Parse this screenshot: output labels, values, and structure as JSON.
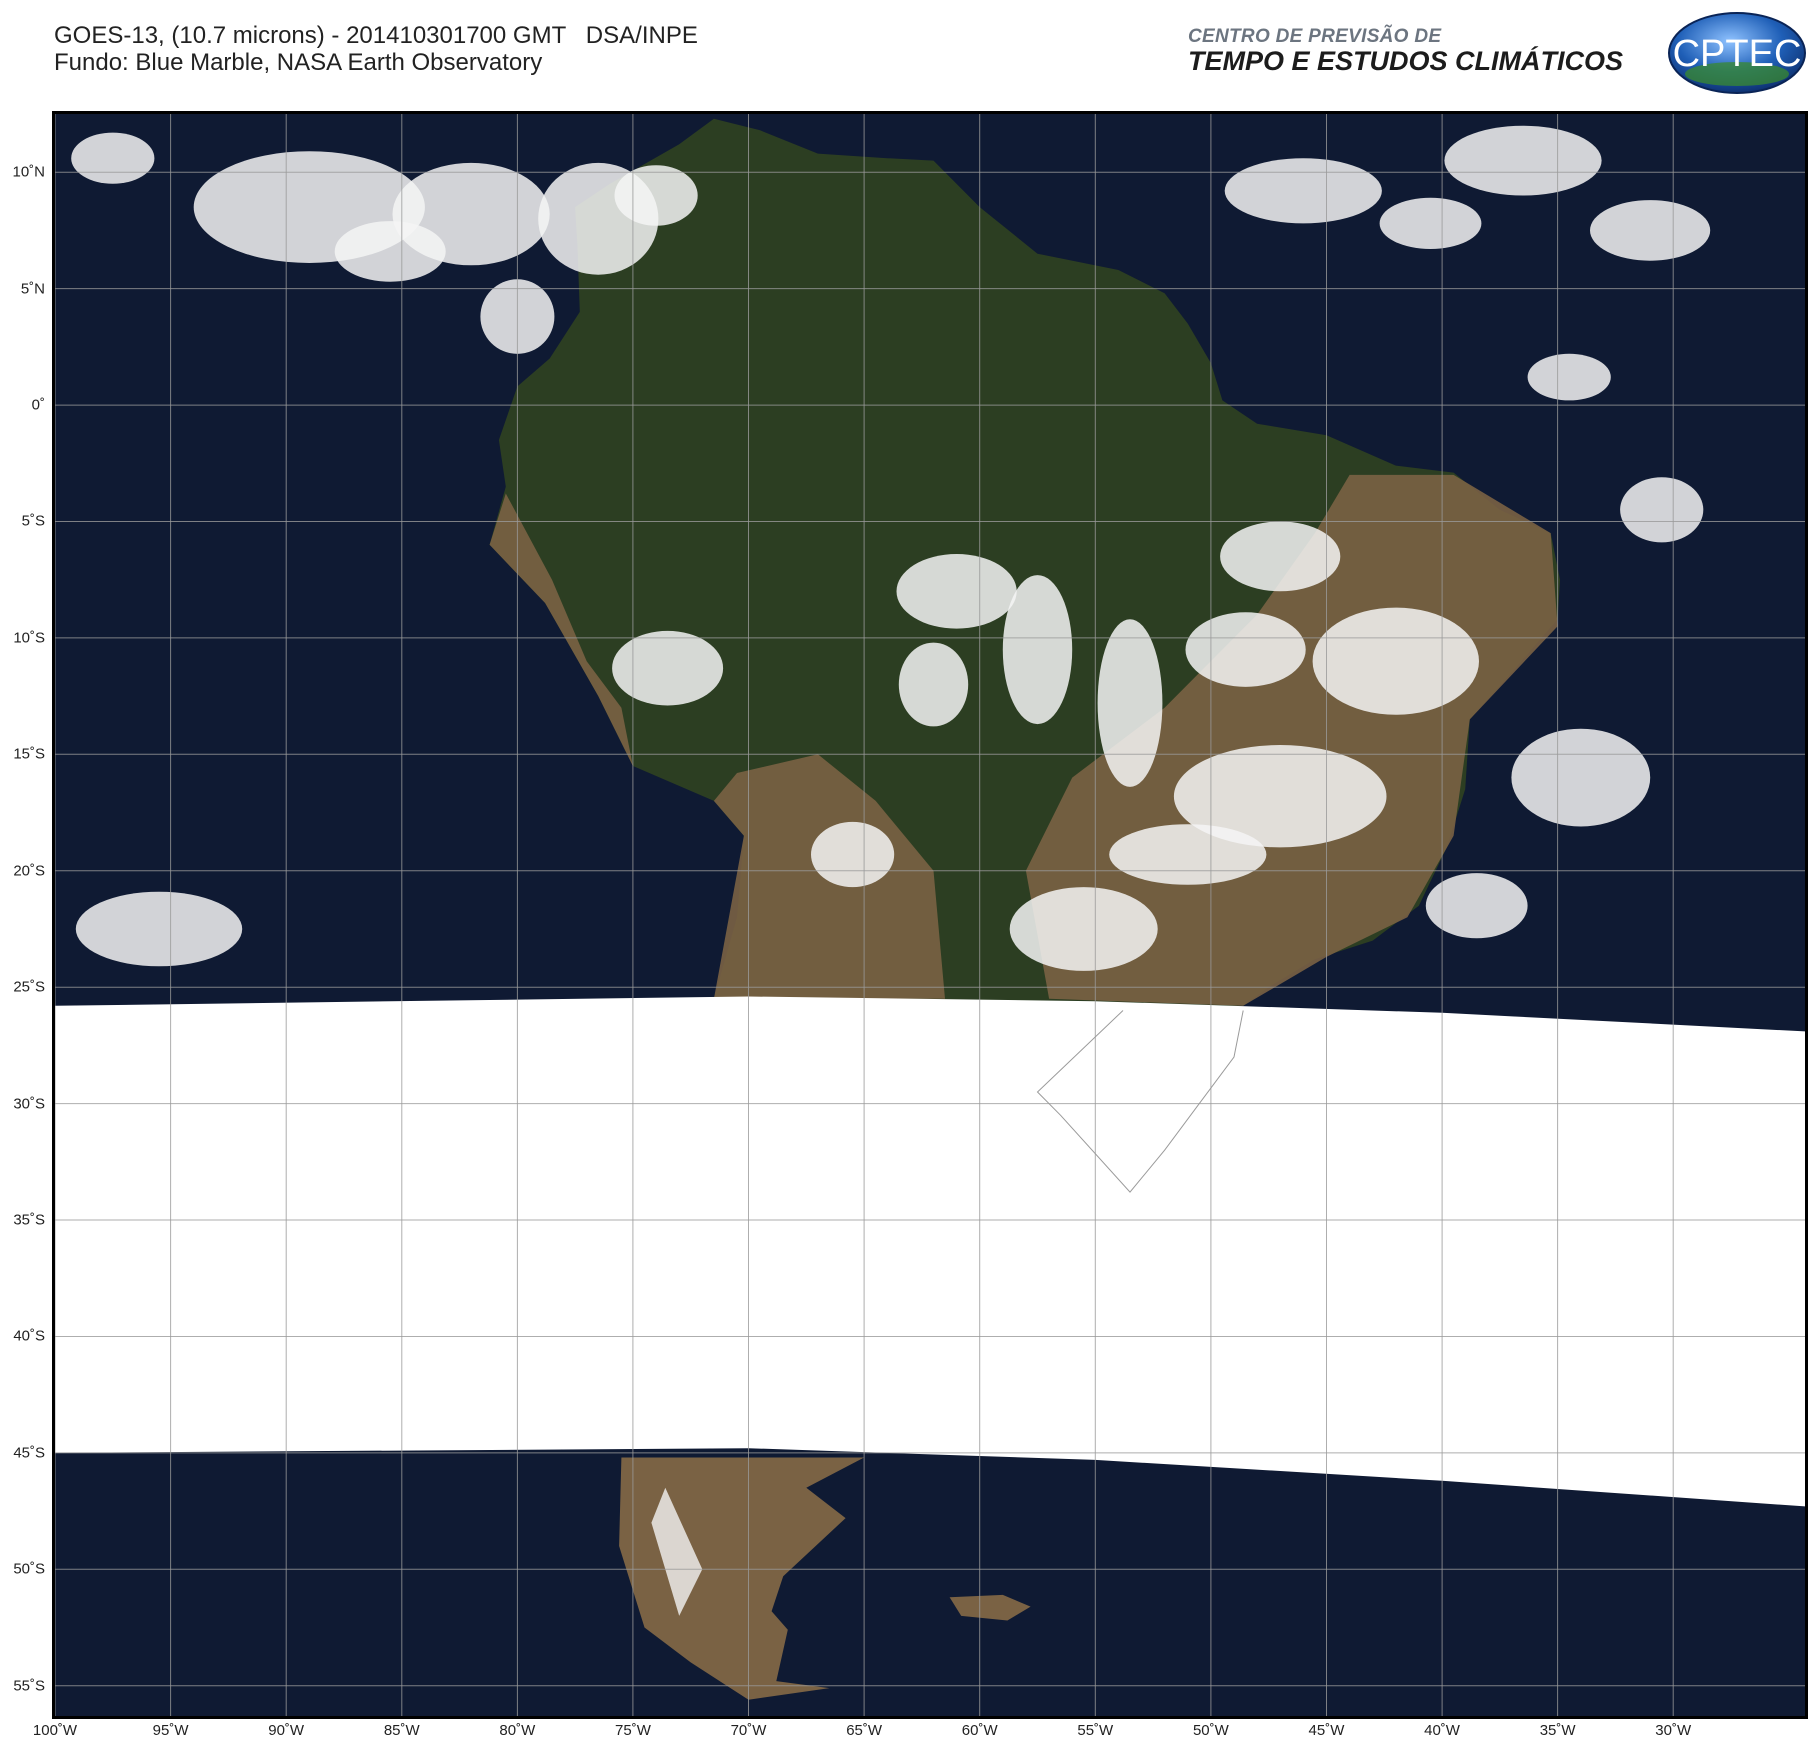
{
  "header": {
    "line1": "GOES-13, (10.7 microns) - 201410301700 GMT   DSA/INPE",
    "line2": "Fundo: Blue Marble, NASA Earth Observatory"
  },
  "organization": {
    "subtitle": "CENTRO DE PREVISÃO DE",
    "title": "TEMPO E ESTUDOS CLIMÁTICOS",
    "logo_text": "CPTEC"
  },
  "map": {
    "lat_range": [
      -56.3,
      12.5
    ],
    "lon_range": [
      -100,
      -24.3
    ],
    "lat_ticks": [
      {
        "value": 10,
        "label": "10˚N"
      },
      {
        "value": 5,
        "label": "5˚N"
      },
      {
        "value": 0,
        "label": "0˚"
      },
      {
        "value": -5,
        "label": "5˚S"
      },
      {
        "value": -10,
        "label": "10˚S"
      },
      {
        "value": -15,
        "label": "15˚S"
      },
      {
        "value": -20,
        "label": "20˚S"
      },
      {
        "value": -25,
        "label": "25˚S"
      },
      {
        "value": -30,
        "label": "30˚S"
      },
      {
        "value": -35,
        "label": "35˚S"
      },
      {
        "value": -40,
        "label": "40˚S"
      },
      {
        "value": -45,
        "label": "45˚S"
      },
      {
        "value": -50,
        "label": "50˚S"
      },
      {
        "value": -55,
        "label": "55˚S"
      }
    ],
    "lon_ticks": [
      {
        "value": -100,
        "label": "100˚W"
      },
      {
        "value": -95,
        "label": "95˚W"
      },
      {
        "value": -90,
        "label": "90˚W"
      },
      {
        "value": -85,
        "label": "85˚W"
      },
      {
        "value": -80,
        "label": "80˚W"
      },
      {
        "value": -75,
        "label": "75˚W"
      },
      {
        "value": -70,
        "label": "70˚W"
      },
      {
        "value": -65,
        "label": "65˚W"
      },
      {
        "value": -60,
        "label": "60˚W"
      },
      {
        "value": -55,
        "label": "55˚W"
      },
      {
        "value": -50,
        "label": "50˚W"
      },
      {
        "value": -45,
        "label": "45˚W"
      },
      {
        "value": -40,
        "label": "40˚W"
      },
      {
        "value": -35,
        "label": "35˚W"
      },
      {
        "value": -30,
        "label": "30˚W"
      }
    ],
    "colors": {
      "ocean": "#0f1a33",
      "forest": "#2c3e22",
      "arid": "#7a6244",
      "cloud": "#f4f4f4",
      "no_data": "#ffffff",
      "grid": "#9a9a9a",
      "border": "#c8c8c8"
    }
  }
}
